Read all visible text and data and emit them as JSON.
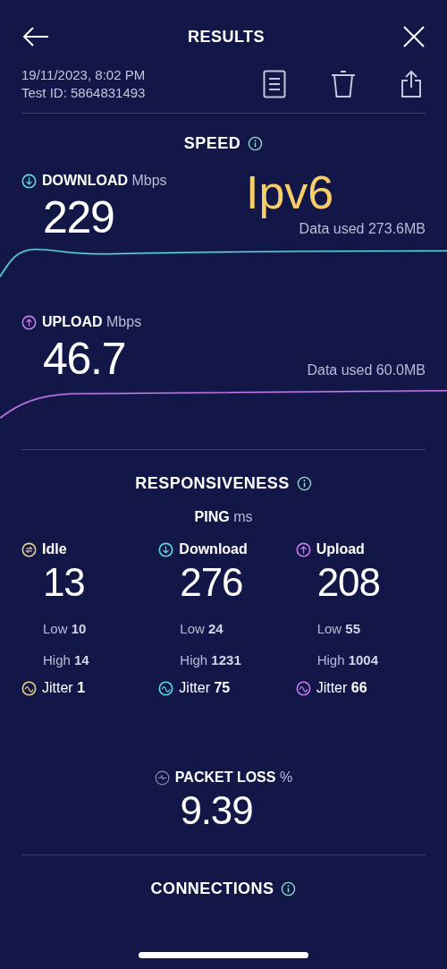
{
  "header": {
    "title": "RESULTS"
  },
  "meta": {
    "date": "19/11/2023, 8:02 PM",
    "test_id": "Test ID: 5864831493"
  },
  "speed": {
    "title": "SPEED",
    "annotation": "Ipv6",
    "metrics": [
      {
        "kind": "download",
        "label": "DOWNLOAD",
        "unit": "Mbps",
        "value": "229",
        "data_used": "Data used 273.6MB",
        "color": "#5fd8e4"
      },
      {
        "kind": "upload",
        "label": "UPLOAD",
        "unit": "Mbps",
        "value": "46.7",
        "data_used": "Data used 60.0MB",
        "color": "#c57cf0"
      }
    ]
  },
  "responsiveness": {
    "title": "RESPONSIVENESS",
    "ping_label": "PING",
    "ping_unit": "ms",
    "columns": [
      {
        "kind": "idle",
        "label": "Idle",
        "value": "13",
        "low_label": "Low",
        "low": "10",
        "high_label": "High",
        "high": "14",
        "jitter_label": "Jitter",
        "jitter": "1",
        "color": "#e6d28a"
      },
      {
        "kind": "download",
        "label": "Download",
        "value": "276",
        "low_label": "Low",
        "low": "24",
        "high_label": "High",
        "high": "1231",
        "jitter_label": "Jitter",
        "jitter": "75",
        "color": "#5fd8e4"
      },
      {
        "kind": "upload",
        "label": "Upload",
        "value": "208",
        "low_label": "Low",
        "low": "55",
        "high_label": "High",
        "high": "1004",
        "jitter_label": "Jitter",
        "jitter": "66",
        "color": "#c57cf0"
      }
    ]
  },
  "packet_loss": {
    "label": "PACKET LOSS",
    "unit": "%",
    "value": "9.39"
  },
  "connections": {
    "title": "CONNECTIONS"
  }
}
